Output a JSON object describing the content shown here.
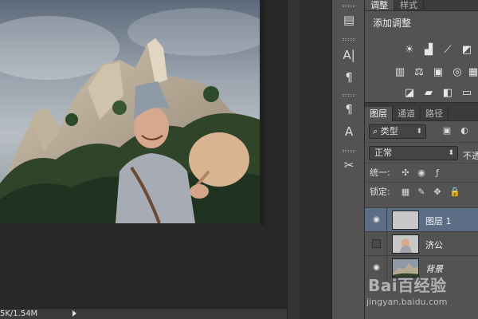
{
  "status_bar": {
    "doc_info": "5K/1.54M"
  },
  "tool_strip": {
    "items": [
      "history-icon",
      "character-icon",
      "paragraph-icon",
      "character-styles-icon",
      "paragraph-styles-icon",
      "tool-presets-icon"
    ]
  },
  "adjustments_panel": {
    "tabs": [
      "调整",
      "样式"
    ],
    "title": "添加调整",
    "icons": [
      "brightness-icon",
      "levels-icon",
      "curves-icon",
      "exposure-icon",
      "vibrance-icon",
      "hue-sat-icon",
      "color-balance-icon",
      "bw-icon",
      "photo-filter-icon",
      "channel-mixer-icon",
      "color-lookup-icon",
      "invert-icon",
      "posterize-icon",
      "threshold-icon",
      "gradient-map-icon"
    ]
  },
  "layers_panel": {
    "tabs": [
      "图层",
      "通道",
      "路径"
    ],
    "filter_kind": "类型",
    "blend_mode": "正常",
    "opacity_label": "不透",
    "unify_label": "统一:",
    "lock_label": "锁定:",
    "layers": [
      {
        "name": "图层 1",
        "visible": true,
        "selected": true
      },
      {
        "name": "济公",
        "visible": false,
        "selected": false
      },
      {
        "name": "背景",
        "visible": true,
        "selected": false
      }
    ]
  },
  "watermark": {
    "logo": "Bai百经验",
    "url": "jingyan.baidu.com"
  }
}
